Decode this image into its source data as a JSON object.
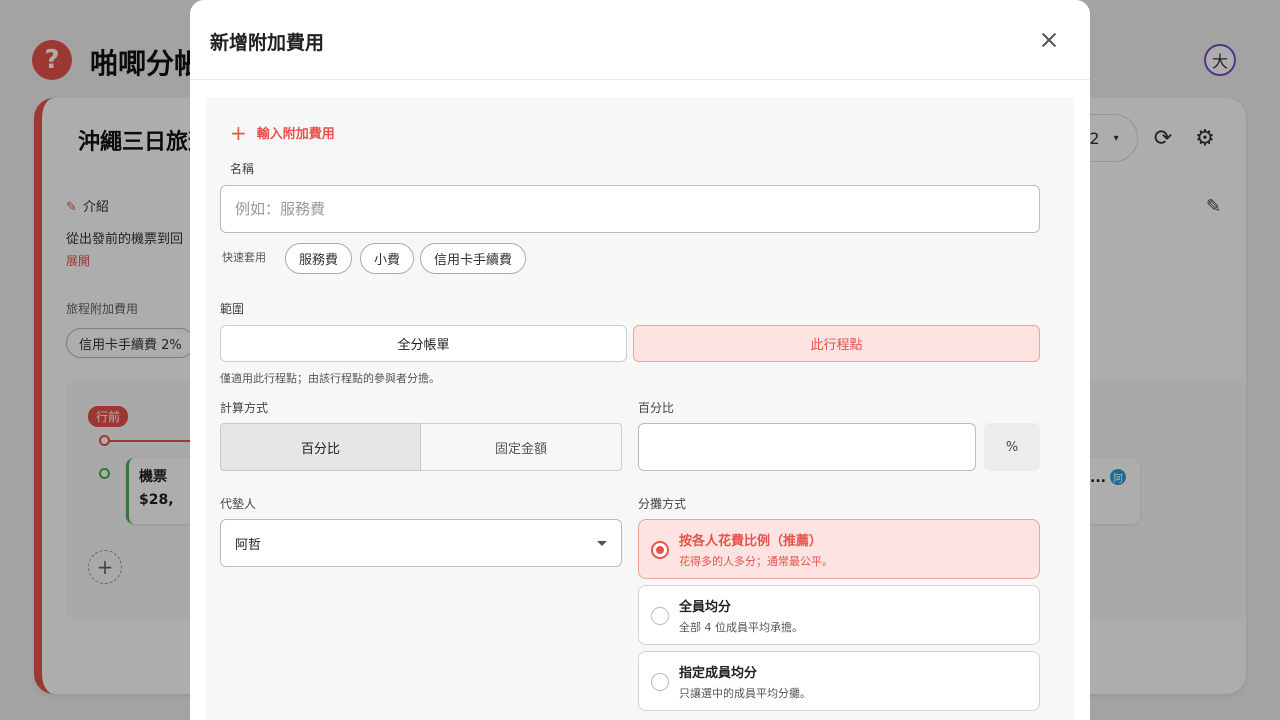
{
  "background": {
    "app_title": "啪唧分帳",
    "logo_glyph": "?",
    "avatar_initial": "大",
    "trip_title": "沖繩三日旅遊",
    "member_count": "2",
    "intro_label": "介紹",
    "intro_text": "從出發前的機票到回",
    "expand_link": "展開",
    "fees_label": "旅程附加費用",
    "fee_chip": "信用卡手續費 2%",
    "before_badge": "行前",
    "item_title": "機票",
    "item_amount": "$28,",
    "right_item_dots": "...",
    "right_item_badge": "阿"
  },
  "modal": {
    "title": "新增附加費用",
    "add_link_label": "輸入附加費用",
    "name_label": "名稱",
    "name_placeholder": "例如：服務費",
    "quick_label": "快速套用",
    "quick_chips": [
      "服務費",
      "小費",
      "信用卡手續費"
    ],
    "scope_label": "範圍",
    "scope_options": [
      "全分帳單",
      "此行程點"
    ],
    "scope_note": "僅適用此行程點；由該行程點的參與者分擔。",
    "calc_label": "計算方式",
    "calc_options": [
      "百分比",
      "固定金額"
    ],
    "pct_label": "百分比",
    "pct_unit": "%",
    "payer_label": "代墊人",
    "payer_value": "阿哲",
    "split_label": "分攤方式",
    "split_options": [
      {
        "title": "按各人花費比例（推薦）",
        "desc": "花得多的人多分；通常最公平。"
      },
      {
        "title": "全員均分",
        "desc": "全部 4 位成員平均承擔。"
      },
      {
        "title": "指定成員均分",
        "desc": "只讓選中的成員平均分攤。"
      }
    ]
  },
  "colors": {
    "accent": "#e8524a",
    "accent_soft": "#fde3e1",
    "success": "#4caf50"
  },
  "icons": {
    "close": "close-icon",
    "plus": "plus-icon",
    "caret": "chevron-down-icon",
    "pin": "pin-icon",
    "sync": "sync-icon",
    "settings": "gear-icon",
    "edit": "pencil-icon"
  }
}
